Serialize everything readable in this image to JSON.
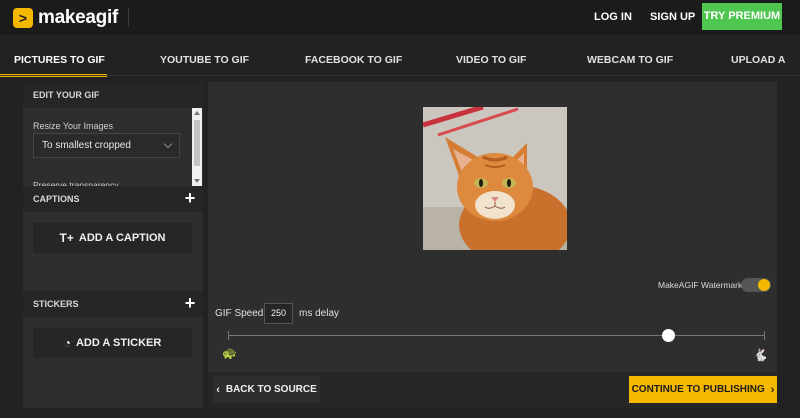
{
  "brand": {
    "name": "makeagif",
    "logo_glyph": ">"
  },
  "header": {
    "login": "LOG IN",
    "signup": "SIGN UP",
    "premium": "TRY PREMIUM"
  },
  "tabs": [
    {
      "label": "PICTURES TO GIF",
      "active": true
    },
    {
      "label": "YOUTUBE TO GIF",
      "active": false
    },
    {
      "label": "FACEBOOK TO GIF",
      "active": false
    },
    {
      "label": "VIDEO TO GIF",
      "active": false
    },
    {
      "label": "WEBCAM TO GIF",
      "active": false
    },
    {
      "label": "UPLOAD A GIF",
      "active": false
    }
  ],
  "left_panel": {
    "edit_heading": "EDIT YOUR GIF",
    "resize_label": "Resize Your Images",
    "resize_value": "To smallest cropped",
    "preserve_label": "Preserve transparency",
    "captions_heading": "CAPTIONS",
    "add_caption": "ADD A CAPTION",
    "stickers_heading": "STICKERS",
    "add_sticker": "ADD A STICKER",
    "plus": "+",
    "caption_icon": "T+",
    "sticker_icon": "◔"
  },
  "main_panel": {
    "watermark_label": "MakeAGIF Watermark",
    "watermark_on": true,
    "speed_label": "GIF Speed:",
    "speed_value": "250",
    "speed_unit": "ms delay",
    "speed_slider_fraction": 0.82,
    "turtle_icon": "🐢",
    "rabbit_icon": "🐇",
    "back_label": "BACK TO SOURCE",
    "back_chevron": "‹",
    "continue_label": "CONTINUE TO PUBLISHING",
    "continue_chevron": "›"
  },
  "colors": {
    "accent": "#f5b800",
    "premium": "#4fc64f",
    "background": "#222222",
    "panel": "#2e2e2e"
  }
}
